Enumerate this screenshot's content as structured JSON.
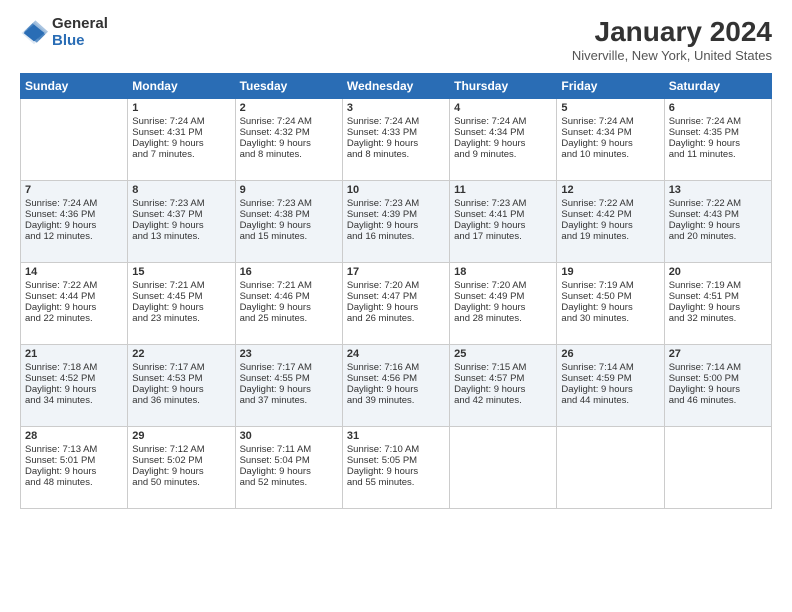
{
  "header": {
    "logo_general": "General",
    "logo_blue": "Blue",
    "title": "January 2024",
    "location": "Niverville, New York, United States"
  },
  "days_of_week": [
    "Sunday",
    "Monday",
    "Tuesday",
    "Wednesday",
    "Thursday",
    "Friday",
    "Saturday"
  ],
  "weeks": [
    [
      {
        "day": "",
        "content": ""
      },
      {
        "day": "1",
        "content": "Sunrise: 7:24 AM\nSunset: 4:31 PM\nDaylight: 9 hours\nand 7 minutes."
      },
      {
        "day": "2",
        "content": "Sunrise: 7:24 AM\nSunset: 4:32 PM\nDaylight: 9 hours\nand 8 minutes."
      },
      {
        "day": "3",
        "content": "Sunrise: 7:24 AM\nSunset: 4:33 PM\nDaylight: 9 hours\nand 8 minutes."
      },
      {
        "day": "4",
        "content": "Sunrise: 7:24 AM\nSunset: 4:34 PM\nDaylight: 9 hours\nand 9 minutes."
      },
      {
        "day": "5",
        "content": "Sunrise: 7:24 AM\nSunset: 4:34 PM\nDaylight: 9 hours\nand 10 minutes."
      },
      {
        "day": "6",
        "content": "Sunrise: 7:24 AM\nSunset: 4:35 PM\nDaylight: 9 hours\nand 11 minutes."
      }
    ],
    [
      {
        "day": "7",
        "content": "Sunrise: 7:24 AM\nSunset: 4:36 PM\nDaylight: 9 hours\nand 12 minutes."
      },
      {
        "day": "8",
        "content": "Sunrise: 7:23 AM\nSunset: 4:37 PM\nDaylight: 9 hours\nand 13 minutes."
      },
      {
        "day": "9",
        "content": "Sunrise: 7:23 AM\nSunset: 4:38 PM\nDaylight: 9 hours\nand 15 minutes."
      },
      {
        "day": "10",
        "content": "Sunrise: 7:23 AM\nSunset: 4:39 PM\nDaylight: 9 hours\nand 16 minutes."
      },
      {
        "day": "11",
        "content": "Sunrise: 7:23 AM\nSunset: 4:41 PM\nDaylight: 9 hours\nand 17 minutes."
      },
      {
        "day": "12",
        "content": "Sunrise: 7:22 AM\nSunset: 4:42 PM\nDaylight: 9 hours\nand 19 minutes."
      },
      {
        "day": "13",
        "content": "Sunrise: 7:22 AM\nSunset: 4:43 PM\nDaylight: 9 hours\nand 20 minutes."
      }
    ],
    [
      {
        "day": "14",
        "content": "Sunrise: 7:22 AM\nSunset: 4:44 PM\nDaylight: 9 hours\nand 22 minutes."
      },
      {
        "day": "15",
        "content": "Sunrise: 7:21 AM\nSunset: 4:45 PM\nDaylight: 9 hours\nand 23 minutes."
      },
      {
        "day": "16",
        "content": "Sunrise: 7:21 AM\nSunset: 4:46 PM\nDaylight: 9 hours\nand 25 minutes."
      },
      {
        "day": "17",
        "content": "Sunrise: 7:20 AM\nSunset: 4:47 PM\nDaylight: 9 hours\nand 26 minutes."
      },
      {
        "day": "18",
        "content": "Sunrise: 7:20 AM\nSunset: 4:49 PM\nDaylight: 9 hours\nand 28 minutes."
      },
      {
        "day": "19",
        "content": "Sunrise: 7:19 AM\nSunset: 4:50 PM\nDaylight: 9 hours\nand 30 minutes."
      },
      {
        "day": "20",
        "content": "Sunrise: 7:19 AM\nSunset: 4:51 PM\nDaylight: 9 hours\nand 32 minutes."
      }
    ],
    [
      {
        "day": "21",
        "content": "Sunrise: 7:18 AM\nSunset: 4:52 PM\nDaylight: 9 hours\nand 34 minutes."
      },
      {
        "day": "22",
        "content": "Sunrise: 7:17 AM\nSunset: 4:53 PM\nDaylight: 9 hours\nand 36 minutes."
      },
      {
        "day": "23",
        "content": "Sunrise: 7:17 AM\nSunset: 4:55 PM\nDaylight: 9 hours\nand 37 minutes."
      },
      {
        "day": "24",
        "content": "Sunrise: 7:16 AM\nSunset: 4:56 PM\nDaylight: 9 hours\nand 39 minutes."
      },
      {
        "day": "25",
        "content": "Sunrise: 7:15 AM\nSunset: 4:57 PM\nDaylight: 9 hours\nand 42 minutes."
      },
      {
        "day": "26",
        "content": "Sunrise: 7:14 AM\nSunset: 4:59 PM\nDaylight: 9 hours\nand 44 minutes."
      },
      {
        "day": "27",
        "content": "Sunrise: 7:14 AM\nSunset: 5:00 PM\nDaylight: 9 hours\nand 46 minutes."
      }
    ],
    [
      {
        "day": "28",
        "content": "Sunrise: 7:13 AM\nSunset: 5:01 PM\nDaylight: 9 hours\nand 48 minutes."
      },
      {
        "day": "29",
        "content": "Sunrise: 7:12 AM\nSunset: 5:02 PM\nDaylight: 9 hours\nand 50 minutes."
      },
      {
        "day": "30",
        "content": "Sunrise: 7:11 AM\nSunset: 5:04 PM\nDaylight: 9 hours\nand 52 minutes."
      },
      {
        "day": "31",
        "content": "Sunrise: 7:10 AM\nSunset: 5:05 PM\nDaylight: 9 hours\nand 55 minutes."
      },
      {
        "day": "",
        "content": ""
      },
      {
        "day": "",
        "content": ""
      },
      {
        "day": "",
        "content": ""
      }
    ]
  ]
}
